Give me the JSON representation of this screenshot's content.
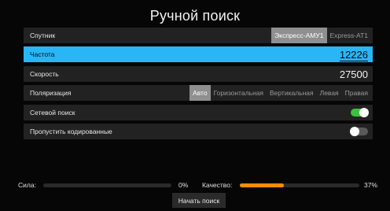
{
  "title": "Ручной поиск",
  "satellite": {
    "label": "Спутник",
    "options": [
      "Экспресс-АМУ1",
      "Express-AT1"
    ],
    "selected": "Экспресс-АМУ1"
  },
  "frequency": {
    "label": "Частота",
    "value": "12226"
  },
  "symbol_rate": {
    "label": "Скорость",
    "value": "27500"
  },
  "polarization": {
    "label": "Поляризация",
    "options": [
      "Авто",
      "Горизонтальная",
      "Вертикальная",
      "Левая",
      "Правая"
    ],
    "selected": "Авто"
  },
  "network_search": {
    "label": "Сетевой поиск",
    "enabled": true
  },
  "skip_scrambled": {
    "label": "Пропустить кодированные",
    "enabled": false
  },
  "signal": {
    "strength_label": "Сила:",
    "strength_value": "0%",
    "strength_fraction": 0.0,
    "quality_label": "Качество:",
    "quality_value": "37%",
    "quality_fraction": 0.37
  },
  "start_button": "Начать поиск",
  "colors": {
    "selected_row": "#29b6f6",
    "toggle_on": "#3cc23a",
    "quality_fill": "#ff8c00"
  }
}
